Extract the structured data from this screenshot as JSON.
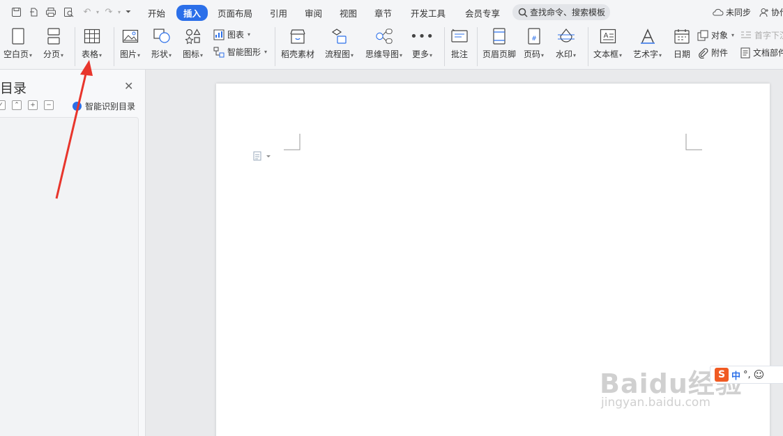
{
  "menu": {
    "items": [
      "开始",
      "插入",
      "页面布局",
      "引用",
      "审阅",
      "视图",
      "章节",
      "开发工具",
      "会员专享"
    ],
    "active": "插入",
    "search_placeholder": "查找命令、搜索模板",
    "sync": "未同步",
    "collab": "协作"
  },
  "ribbon": {
    "blank_page": "空白页",
    "page_break": "分页",
    "table": "表格",
    "picture": "图片",
    "shape": "形状",
    "icon": "图标",
    "chart": "图表",
    "smart_graphic": "智能图形",
    "docer": "稻壳素材",
    "flowchart": "流程图",
    "mindmap": "思维导图",
    "more": "更多",
    "comment": "批注",
    "header_footer": "页眉页脚",
    "page_number": "页码",
    "watermark": "水印",
    "textbox": "文本框",
    "wordart": "艺术字",
    "date": "日期",
    "object": "对象",
    "attachment": "附件",
    "dropcap": "首字下沉",
    "doc_part": "文档部件"
  },
  "toc_pane": {
    "title": "目录",
    "smart_toc": "智能识别目录"
  },
  "ime": {
    "mode": "中",
    "punct": "°,"
  },
  "watermark": {
    "brand": "Baidu经验",
    "url": "jingyan.baidu.com"
  },
  "colors": {
    "accent": "#2b6fe9",
    "arrow": "#e8352c",
    "ime_logo": "#f05a22"
  }
}
